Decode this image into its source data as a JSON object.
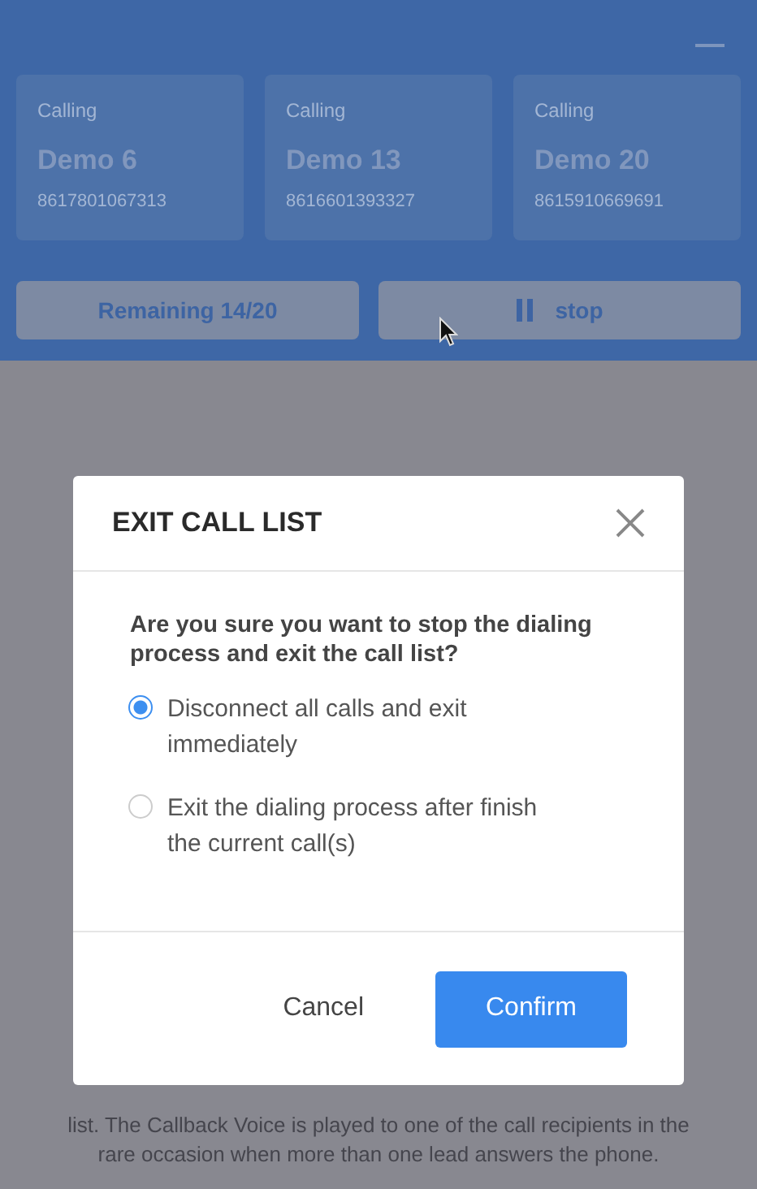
{
  "calls": [
    {
      "status": "Calling",
      "name": "Demo 6",
      "number": "8617801067313"
    },
    {
      "status": "Calling",
      "name": "Demo 13",
      "number": "8616601393327"
    },
    {
      "status": "Calling",
      "name": "Demo 20",
      "number": "8615910669691"
    }
  ],
  "remaining": "Remaining 14/20",
  "stop_button": "stop",
  "background_text": "list. The Callback Voice is played to one of the call recipients in the rare occasion when more than one lead answers the phone.",
  "dialog": {
    "title": "EXIT CALL LIST",
    "question": "Are you sure you want to stop the dialing process and exit the call list?",
    "options": [
      {
        "label": "Disconnect all calls and exit immediately",
        "selected": true
      },
      {
        "label": "Exit the dialing process after finish the current call(s)",
        "selected": false
      }
    ],
    "buttons": [
      {
        "label": "Cancel",
        "kind": "secondary"
      },
      {
        "label": "Confirm",
        "kind": "primary"
      }
    ]
  }
}
